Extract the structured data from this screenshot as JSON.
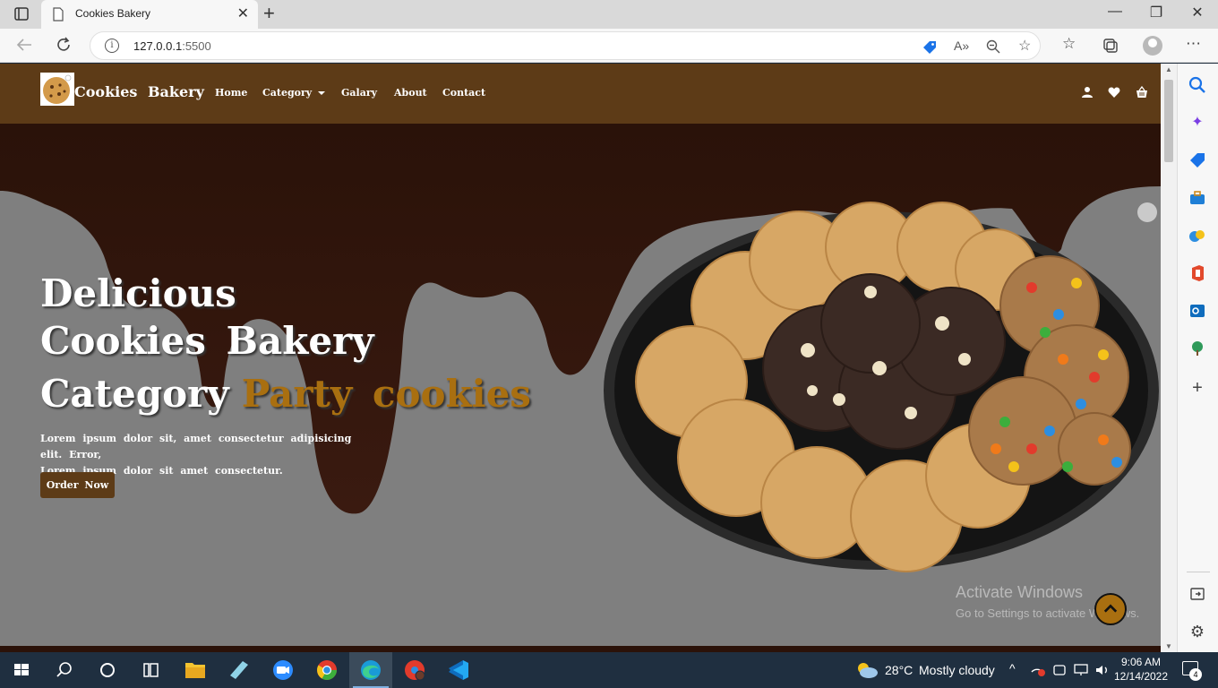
{
  "browser": {
    "tab_title": "Cookies Bakery",
    "url_host": "127.0.0.1",
    "url_port": ":5500",
    "tab_close": "✕",
    "new_tab": "+",
    "window_minimize": "—",
    "window_restore": "❐",
    "window_close": "✕"
  },
  "navbar": {
    "brand": "Cookies Bakery",
    "links": [
      "Home",
      "Category",
      "Galary",
      "About",
      "Contact"
    ]
  },
  "hero": {
    "line1": "Delicious",
    "line2": "Cookies Bakery",
    "line3_prefix": "Category",
    "line3_accent": "Party cookies",
    "lorem_1": "Lorem ipsum dolor sit, amet consectetur adipisicing elit. Error,",
    "lorem_2": "Lorem ipsum dolor sit amet consectetur.",
    "order_button": "Order Now"
  },
  "watermark": {
    "title": "Activate Windows",
    "subtitle": "Go to Settings to activate Windows."
  },
  "taskbar": {
    "temperature": "28°C",
    "weather": "Mostly cloudy",
    "time": "9:06 AM",
    "date": "12/14/2022",
    "notification_count": "4"
  },
  "colors": {
    "navbar_brown": "#5d3b17",
    "accent_gold": "#a96f10",
    "hero_gray": "#7f7f7f",
    "chocolate": "#2b1209"
  }
}
